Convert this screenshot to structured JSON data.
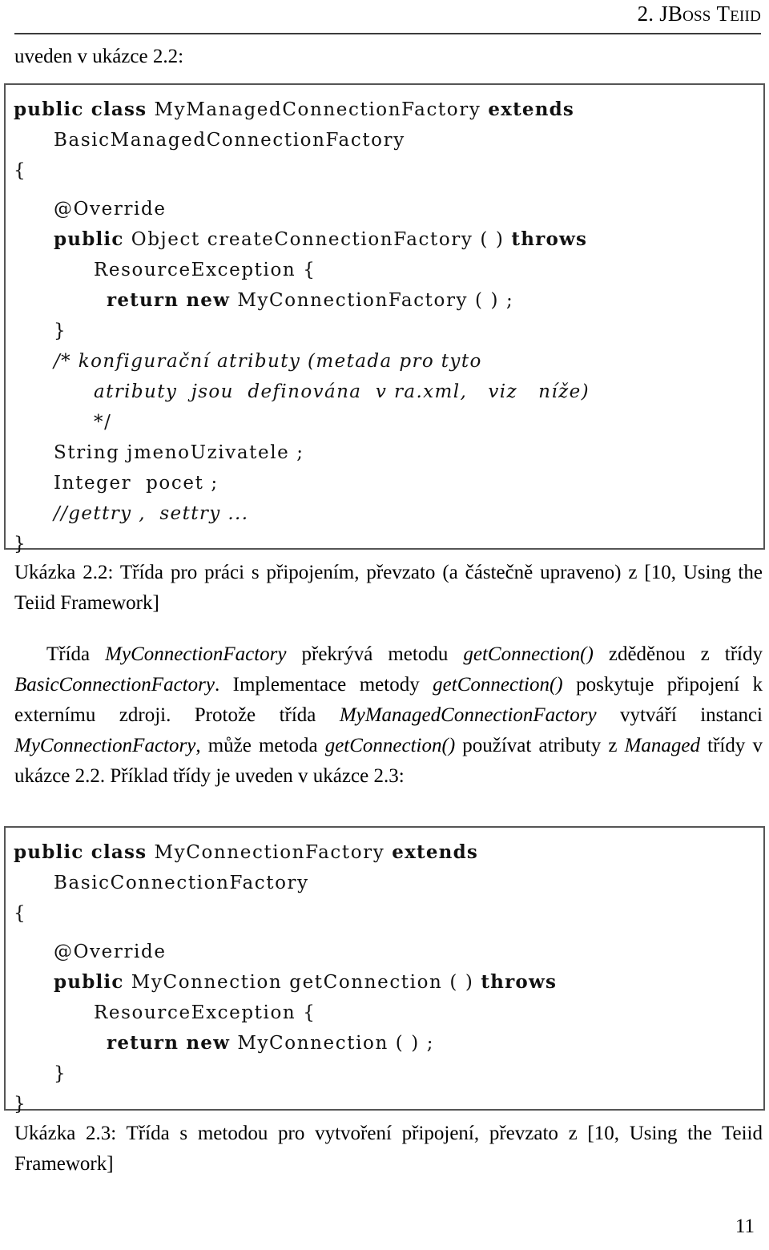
{
  "header": {
    "chapter_number": "2.",
    "chapter_title_first": "JB",
    "chapter_title_first_small": "oss",
    "chapter_title_second": "T",
    "chapter_title_second_small": "eiid",
    "full_text": "2. JBoss Teiid"
  },
  "lead": {
    "text": "uveden v ukázce 2.2:"
  },
  "listing1": {
    "lines": [
      {
        "indent": 0,
        "parts": [
          {
            "t": "public class ",
            "s": "kw"
          },
          {
            "t": "MyManagedConnectionFactory ",
            "s": "id"
          },
          {
            "t": "extends",
            "s": "kw"
          }
        ]
      },
      {
        "indent": 1,
        "parts": [
          {
            "t": "BasicManagedConnectionFactory",
            "s": "id"
          }
        ]
      },
      {
        "indent": 0,
        "parts": [
          {
            "t": "{",
            "s": "id"
          }
        ]
      },
      {
        "indent": 0,
        "parts": [
          {
            "t": "",
            "s": "blank"
          }
        ]
      },
      {
        "indent": 1,
        "parts": [
          {
            "t": "@Override",
            "s": "id"
          }
        ]
      },
      {
        "indent": 1,
        "parts": [
          {
            "t": "public ",
            "s": "kw"
          },
          {
            "t": "Object createConnectionFactory ( ) ",
            "s": "id"
          },
          {
            "t": "throws",
            "s": "kw"
          }
        ]
      },
      {
        "indent": 2,
        "parts": [
          {
            "t": "ResourceException {",
            "s": "id"
          }
        ]
      },
      {
        "indent": 3,
        "parts": [
          {
            "t": "return new ",
            "s": "kw"
          },
          {
            "t": "MyConnectionFactory ( ) ;",
            "s": "id"
          }
        ]
      },
      {
        "indent": 1,
        "parts": [
          {
            "t": "}",
            "s": "id"
          }
        ]
      },
      {
        "indent": 1,
        "parts": [
          {
            "t": "/* konfigurační atributy (metada pro tyto",
            "s": "cm"
          }
        ]
      },
      {
        "indent": 2,
        "parts": [
          {
            "t": "atributy  jsou  definována  v ra.xml,   viz   níže)",
            "s": "cm"
          }
        ]
      },
      {
        "indent": 2,
        "parts": [
          {
            "t": "*/",
            "s": "id"
          }
        ]
      },
      {
        "indent": 1,
        "parts": [
          {
            "t": "String jmenoUzivatele ;",
            "s": "id"
          }
        ]
      },
      {
        "indent": 1,
        "parts": [
          {
            "t": "Integer  pocet ;",
            "s": "id"
          }
        ]
      },
      {
        "indent": 1,
        "parts": [
          {
            "t": "//gettry ,  settry ...",
            "s": "cm"
          }
        ]
      },
      {
        "indent": 0,
        "parts": [
          {
            "t": "}",
            "s": "id"
          }
        ]
      }
    ]
  },
  "caption1": {
    "label": "Ukázka 2.2:",
    "text": " Třída pro práci s připojením, převzato (a částečně upraveno) z [10, Using the Teiid Framework]"
  },
  "paragraph1": {
    "runs": [
      {
        "t": "Třída ",
        "s": "r"
      },
      {
        "t": "MyConnectionFactory",
        "s": "i"
      },
      {
        "t": " překrývá metodu ",
        "s": "r"
      },
      {
        "t": "getConnection()",
        "s": "i"
      },
      {
        "t": " zděděnou z třídy ",
        "s": "r"
      },
      {
        "t": "BasicConnectionFactory",
        "s": "i"
      },
      {
        "t": ". Implementace metody ",
        "s": "r"
      },
      {
        "t": "getConnection()",
        "s": "i"
      },
      {
        "t": " poskytuje připojení k externímu zdroji. Protože třída ",
        "s": "r"
      },
      {
        "t": "MyManagedConnectionFactory",
        "s": "i"
      },
      {
        "t": " vytváří instanci ",
        "s": "r"
      },
      {
        "t": "MyConnectionFactory",
        "s": "i"
      },
      {
        "t": ", může metoda ",
        "s": "r"
      },
      {
        "t": "getConnection()",
        "s": "i"
      },
      {
        "t": " používat atributy z ",
        "s": "r"
      },
      {
        "t": "Managed",
        "s": "i"
      },
      {
        "t": " třídy v ukázce 2.2. Příklad třídy je uveden v ukázce 2.3:",
        "s": "r"
      }
    ]
  },
  "listing2": {
    "lines": [
      {
        "indent": 0,
        "parts": [
          {
            "t": "public class ",
            "s": "kw"
          },
          {
            "t": "MyConnectionFactory ",
            "s": "id"
          },
          {
            "t": "extends",
            "s": "kw"
          }
        ]
      },
      {
        "indent": 1,
        "parts": [
          {
            "t": "BasicConnectionFactory",
            "s": "id"
          }
        ]
      },
      {
        "indent": 0,
        "parts": [
          {
            "t": "{",
            "s": "id"
          }
        ]
      },
      {
        "indent": 0,
        "parts": [
          {
            "t": "",
            "s": "blank"
          }
        ]
      },
      {
        "indent": 1,
        "parts": [
          {
            "t": "@Override",
            "s": "id"
          }
        ]
      },
      {
        "indent": 1,
        "parts": [
          {
            "t": "public ",
            "s": "kw"
          },
          {
            "t": "MyConnection getConnection ( ) ",
            "s": "id"
          },
          {
            "t": "throws",
            "s": "kw"
          }
        ]
      },
      {
        "indent": 2,
        "parts": [
          {
            "t": "ResourceException {",
            "s": "id"
          }
        ]
      },
      {
        "indent": 3,
        "parts": [
          {
            "t": "return new ",
            "s": "kw"
          },
          {
            "t": "MyConnection ( ) ;",
            "s": "id"
          }
        ]
      },
      {
        "indent": 1,
        "parts": [
          {
            "t": "}",
            "s": "id"
          }
        ]
      },
      {
        "indent": 0,
        "parts": [
          {
            "t": "}",
            "s": "id"
          }
        ]
      }
    ]
  },
  "caption2": {
    "label": "Ukázka 2.3:",
    "text": " Třída s metodou pro vytvoření připojení, převzato z [10, Using the Teiid Framework]"
  },
  "footer": {
    "page_number": "11"
  },
  "colors": {
    "text": "#000000",
    "rule": "#3c3c3c",
    "box_border": "#555555",
    "background": "#ffffff"
  }
}
